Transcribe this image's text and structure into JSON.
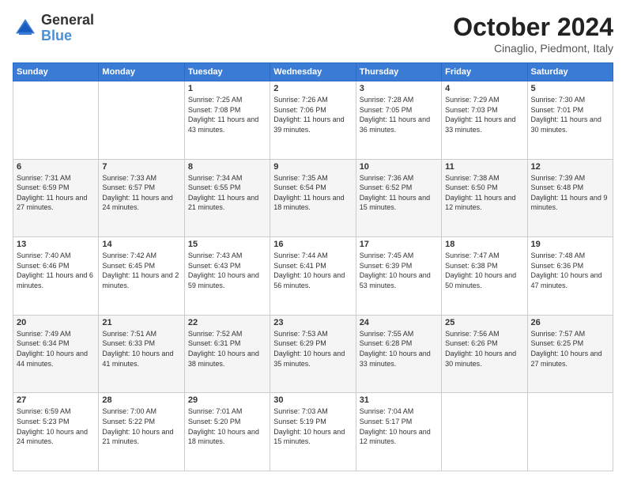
{
  "header": {
    "logo_line1": "General",
    "logo_line2": "Blue",
    "month": "October 2024",
    "location": "Cinaglio, Piedmont, Italy"
  },
  "days_of_week": [
    "Sunday",
    "Monday",
    "Tuesday",
    "Wednesday",
    "Thursday",
    "Friday",
    "Saturday"
  ],
  "weeks": [
    [
      {
        "day": "",
        "sunrise": "",
        "sunset": "",
        "daylight": ""
      },
      {
        "day": "",
        "sunrise": "",
        "sunset": "",
        "daylight": ""
      },
      {
        "day": "1",
        "sunrise": "Sunrise: 7:25 AM",
        "sunset": "Sunset: 7:08 PM",
        "daylight": "Daylight: 11 hours and 43 minutes."
      },
      {
        "day": "2",
        "sunrise": "Sunrise: 7:26 AM",
        "sunset": "Sunset: 7:06 PM",
        "daylight": "Daylight: 11 hours and 39 minutes."
      },
      {
        "day": "3",
        "sunrise": "Sunrise: 7:28 AM",
        "sunset": "Sunset: 7:05 PM",
        "daylight": "Daylight: 11 hours and 36 minutes."
      },
      {
        "day": "4",
        "sunrise": "Sunrise: 7:29 AM",
        "sunset": "Sunset: 7:03 PM",
        "daylight": "Daylight: 11 hours and 33 minutes."
      },
      {
        "day": "5",
        "sunrise": "Sunrise: 7:30 AM",
        "sunset": "Sunset: 7:01 PM",
        "daylight": "Daylight: 11 hours and 30 minutes."
      }
    ],
    [
      {
        "day": "6",
        "sunrise": "Sunrise: 7:31 AM",
        "sunset": "Sunset: 6:59 PM",
        "daylight": "Daylight: 11 hours and 27 minutes."
      },
      {
        "day": "7",
        "sunrise": "Sunrise: 7:33 AM",
        "sunset": "Sunset: 6:57 PM",
        "daylight": "Daylight: 11 hours and 24 minutes."
      },
      {
        "day": "8",
        "sunrise": "Sunrise: 7:34 AM",
        "sunset": "Sunset: 6:55 PM",
        "daylight": "Daylight: 11 hours and 21 minutes."
      },
      {
        "day": "9",
        "sunrise": "Sunrise: 7:35 AM",
        "sunset": "Sunset: 6:54 PM",
        "daylight": "Daylight: 11 hours and 18 minutes."
      },
      {
        "day": "10",
        "sunrise": "Sunrise: 7:36 AM",
        "sunset": "Sunset: 6:52 PM",
        "daylight": "Daylight: 11 hours and 15 minutes."
      },
      {
        "day": "11",
        "sunrise": "Sunrise: 7:38 AM",
        "sunset": "Sunset: 6:50 PM",
        "daylight": "Daylight: 11 hours and 12 minutes."
      },
      {
        "day": "12",
        "sunrise": "Sunrise: 7:39 AM",
        "sunset": "Sunset: 6:48 PM",
        "daylight": "Daylight: 11 hours and 9 minutes."
      }
    ],
    [
      {
        "day": "13",
        "sunrise": "Sunrise: 7:40 AM",
        "sunset": "Sunset: 6:46 PM",
        "daylight": "Daylight: 11 hours and 6 minutes."
      },
      {
        "day": "14",
        "sunrise": "Sunrise: 7:42 AM",
        "sunset": "Sunset: 6:45 PM",
        "daylight": "Daylight: 11 hours and 2 minutes."
      },
      {
        "day": "15",
        "sunrise": "Sunrise: 7:43 AM",
        "sunset": "Sunset: 6:43 PM",
        "daylight": "Daylight: 10 hours and 59 minutes."
      },
      {
        "day": "16",
        "sunrise": "Sunrise: 7:44 AM",
        "sunset": "Sunset: 6:41 PM",
        "daylight": "Daylight: 10 hours and 56 minutes."
      },
      {
        "day": "17",
        "sunrise": "Sunrise: 7:45 AM",
        "sunset": "Sunset: 6:39 PM",
        "daylight": "Daylight: 10 hours and 53 minutes."
      },
      {
        "day": "18",
        "sunrise": "Sunrise: 7:47 AM",
        "sunset": "Sunset: 6:38 PM",
        "daylight": "Daylight: 10 hours and 50 minutes."
      },
      {
        "day": "19",
        "sunrise": "Sunrise: 7:48 AM",
        "sunset": "Sunset: 6:36 PM",
        "daylight": "Daylight: 10 hours and 47 minutes."
      }
    ],
    [
      {
        "day": "20",
        "sunrise": "Sunrise: 7:49 AM",
        "sunset": "Sunset: 6:34 PM",
        "daylight": "Daylight: 10 hours and 44 minutes."
      },
      {
        "day": "21",
        "sunrise": "Sunrise: 7:51 AM",
        "sunset": "Sunset: 6:33 PM",
        "daylight": "Daylight: 10 hours and 41 minutes."
      },
      {
        "day": "22",
        "sunrise": "Sunrise: 7:52 AM",
        "sunset": "Sunset: 6:31 PM",
        "daylight": "Daylight: 10 hours and 38 minutes."
      },
      {
        "day": "23",
        "sunrise": "Sunrise: 7:53 AM",
        "sunset": "Sunset: 6:29 PM",
        "daylight": "Daylight: 10 hours and 35 minutes."
      },
      {
        "day": "24",
        "sunrise": "Sunrise: 7:55 AM",
        "sunset": "Sunset: 6:28 PM",
        "daylight": "Daylight: 10 hours and 33 minutes."
      },
      {
        "day": "25",
        "sunrise": "Sunrise: 7:56 AM",
        "sunset": "Sunset: 6:26 PM",
        "daylight": "Daylight: 10 hours and 30 minutes."
      },
      {
        "day": "26",
        "sunrise": "Sunrise: 7:57 AM",
        "sunset": "Sunset: 6:25 PM",
        "daylight": "Daylight: 10 hours and 27 minutes."
      }
    ],
    [
      {
        "day": "27",
        "sunrise": "Sunrise: 6:59 AM",
        "sunset": "Sunset: 5:23 PM",
        "daylight": "Daylight: 10 hours and 24 minutes."
      },
      {
        "day": "28",
        "sunrise": "Sunrise: 7:00 AM",
        "sunset": "Sunset: 5:22 PM",
        "daylight": "Daylight: 10 hours and 21 minutes."
      },
      {
        "day": "29",
        "sunrise": "Sunrise: 7:01 AM",
        "sunset": "Sunset: 5:20 PM",
        "daylight": "Daylight: 10 hours and 18 minutes."
      },
      {
        "day": "30",
        "sunrise": "Sunrise: 7:03 AM",
        "sunset": "Sunset: 5:19 PM",
        "daylight": "Daylight: 10 hours and 15 minutes."
      },
      {
        "day": "31",
        "sunrise": "Sunrise: 7:04 AM",
        "sunset": "Sunset: 5:17 PM",
        "daylight": "Daylight: 10 hours and 12 minutes."
      },
      {
        "day": "",
        "sunrise": "",
        "sunset": "",
        "daylight": ""
      },
      {
        "day": "",
        "sunrise": "",
        "sunset": "",
        "daylight": ""
      }
    ]
  ]
}
